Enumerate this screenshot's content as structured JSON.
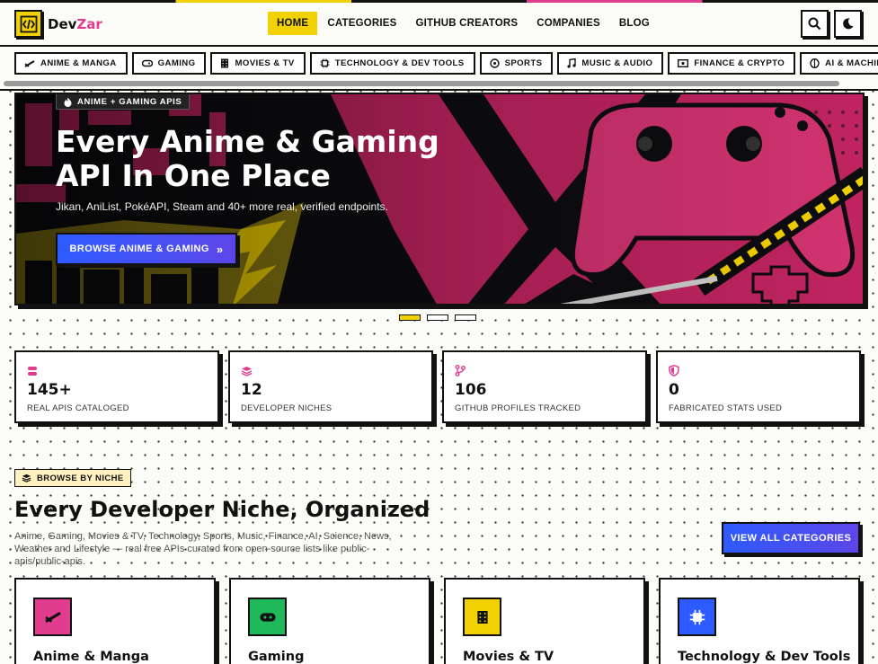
{
  "brand": {
    "name_a": "Dev",
    "name_b": "Zar",
    "icon": "code-icon"
  },
  "nav": {
    "items": [
      "HOME",
      "CATEGORIES",
      "GITHUB CREATORS",
      "COMPANIES",
      "BLOG"
    ],
    "active": "HOME"
  },
  "header_buttons": {
    "search_icon": "search-icon",
    "theme_icon": "moon-icon"
  },
  "chips": [
    {
      "label": "ANIME & MANGA",
      "icon": "katana-icon"
    },
    {
      "label": "GAMING",
      "icon": "gamepad-icon"
    },
    {
      "label": "MOVIES & TV",
      "icon": "film-icon"
    },
    {
      "label": "TECHNOLOGY & DEV TOOLS",
      "icon": "chip-icon"
    },
    {
      "label": "SPORTS",
      "icon": "target-icon"
    },
    {
      "label": "MUSIC & AUDIO",
      "icon": "music-icon"
    },
    {
      "label": "FINANCE & CRYPTO",
      "icon": "money-icon"
    },
    {
      "label": "AI & MACHINE LEARNING",
      "icon": "brain-icon"
    }
  ],
  "hero": {
    "badge": "ANIME + GAMING APIS",
    "title_line1": "Every Anime & Gaming",
    "title_line2": "API In One Place",
    "subtitle": "Jikan, AniList, PokéAPI, Steam and 40+ more real, verified endpoints.",
    "cta": "BROWSE ANIME & GAMING"
  },
  "slides": {
    "count": 3,
    "active_index": 0
  },
  "stats": [
    {
      "value": "145+",
      "label": "REAL APIS CATALOGED",
      "icon": "database-icon"
    },
    {
      "value": "12",
      "label": "DEVELOPER NICHES",
      "icon": "layers-icon"
    },
    {
      "value": "106",
      "label": "GITHUB PROFILES TRACKED",
      "icon": "git-branch-icon"
    },
    {
      "value": "0",
      "label": "FABRICATED STATS USED",
      "icon": "shield-icon"
    }
  ],
  "section": {
    "badge": "BROWSE BY NICHE",
    "title": "Every Developer Niche, Organized",
    "description": "Anime, Gaming, Movies & TV, Technology, Sports, Music, Finance, AI, Science, News, Weather and Lifestyle — real free APIs curated from open-source lists like public-apis/public-apis.",
    "cta": "VIEW ALL CATEGORIES"
  },
  "categories": [
    {
      "title": "Anime & Manga",
      "color": "#e23c8f",
      "icon": "katana-icon"
    },
    {
      "title": "Gaming",
      "color": "#1fb85a",
      "icon": "gamepad-icon"
    },
    {
      "title": "Movies & TV",
      "color": "#f2d100",
      "icon": "film-icon"
    },
    {
      "title": "Technology & Dev Tools",
      "color": "#2e5bff",
      "icon": "chip-icon"
    }
  ],
  "colors": {
    "accent_yellow": "#f2d100",
    "accent_pink": "#e23c8f",
    "accent_blue": "#2e5bff"
  }
}
